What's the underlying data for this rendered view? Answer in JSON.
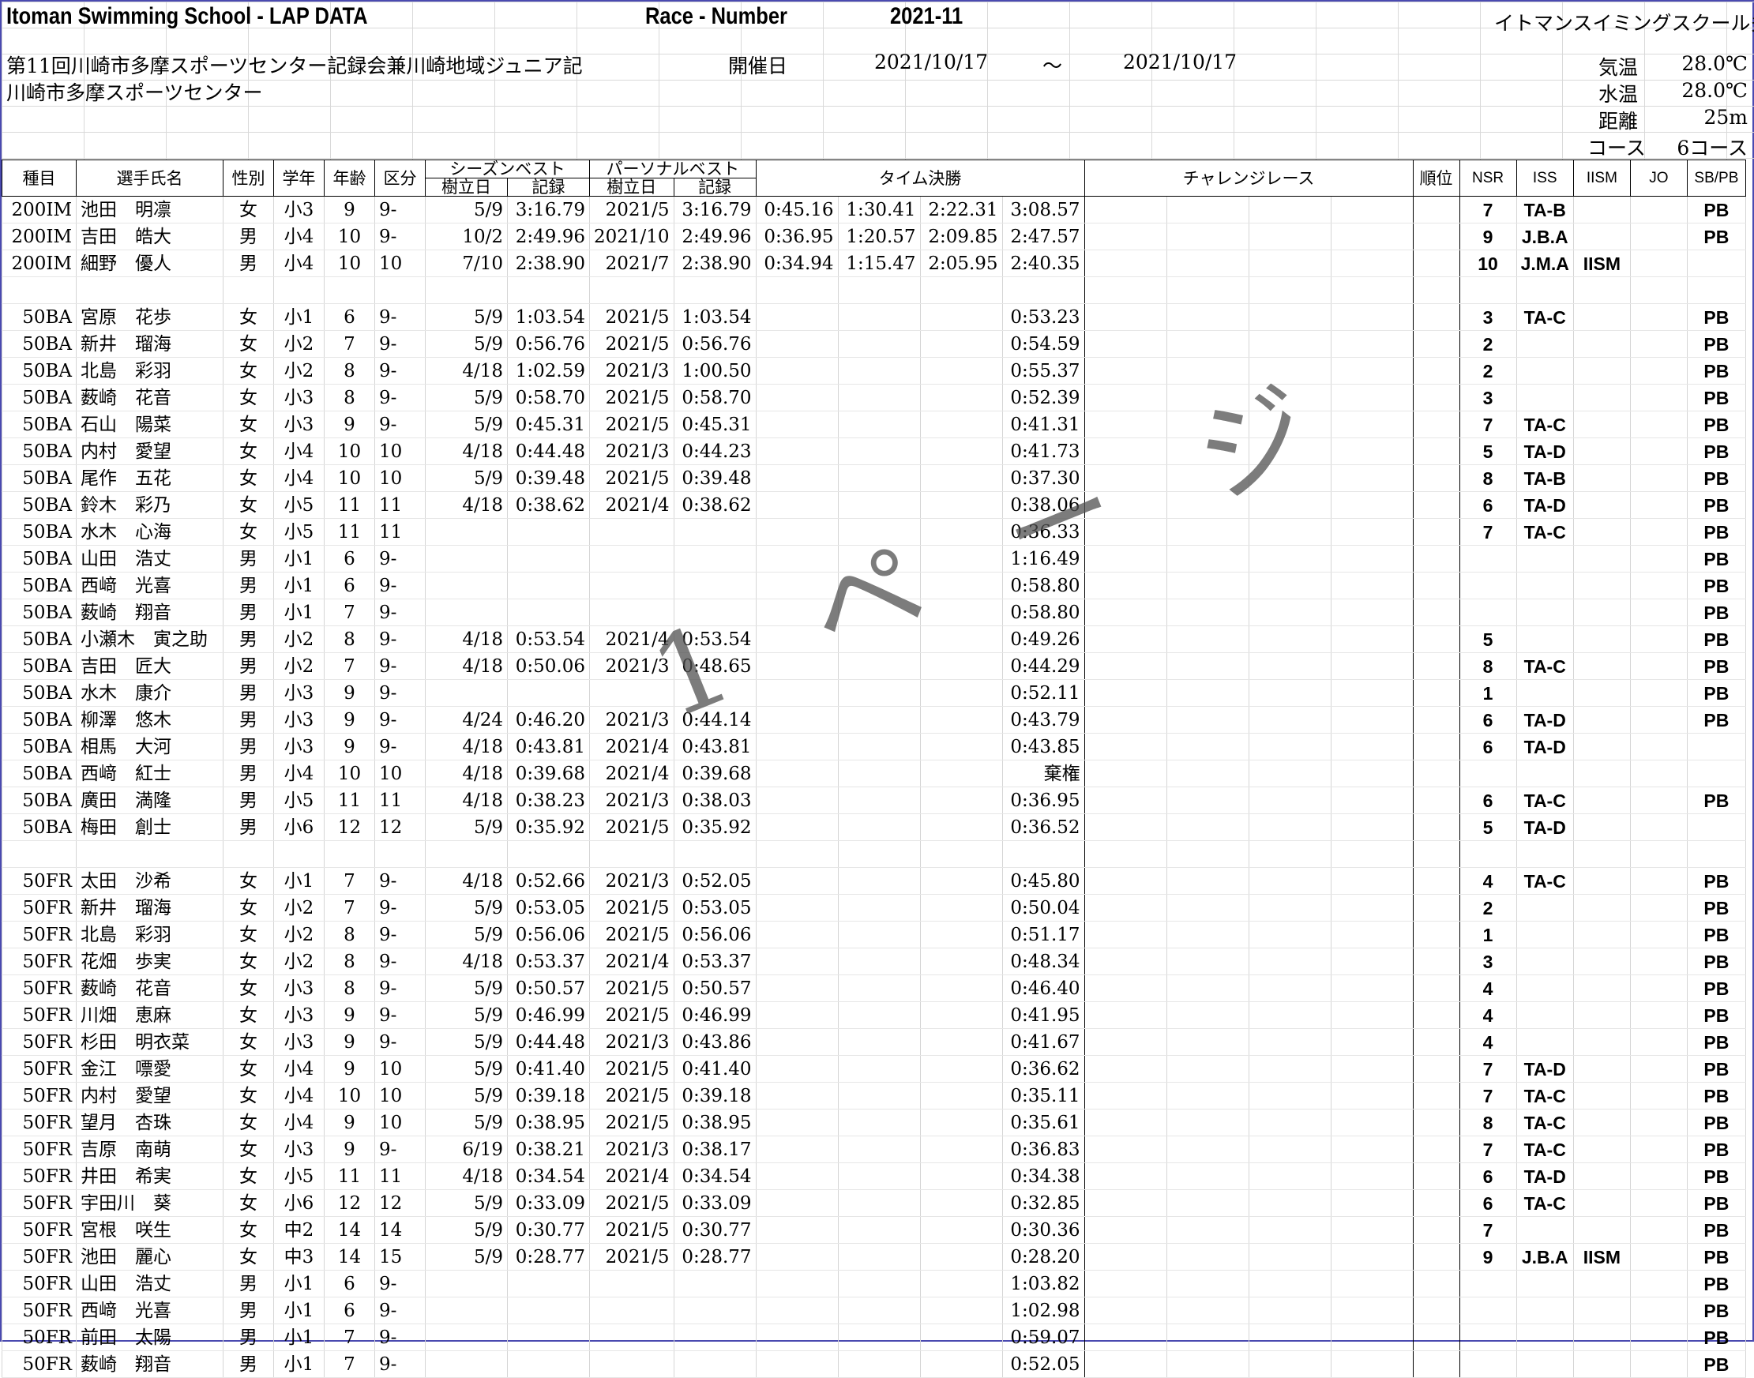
{
  "header": {
    "title": "Itoman Swimming School - LAP DATA",
    "race_number_label": "Race - Number",
    "period": "2021-11",
    "school": "イトマンスイミングスクール多摩校",
    "meet_name": "第11回川崎市多摩スポーツセンター記録会兼川崎地域ジュニア記",
    "venue": "川崎市多摩スポーツセンター",
    "date_label": "開催日",
    "date_from": "2021/10/17",
    "date_sep": "～",
    "date_to": "2021/10/17",
    "air_temp_label": "気温",
    "air_temp": "28.0℃",
    "water_temp_label": "水温",
    "water_temp": "28.0℃",
    "distance_label": "距離",
    "distance": "25m",
    "course_label": "コース",
    "course": "6コース"
  },
  "columns": {
    "event": "種目",
    "name": "選手氏名",
    "sex": "性別",
    "grade": "学年",
    "age": "年齢",
    "division": "区分",
    "season_best": "シーズンベスト",
    "personal_best": "パーソナルベスト",
    "set_date": "樹立日",
    "record": "記録",
    "time_final": "タイム決勝",
    "challenge": "チャレンジレース",
    "rank": "順位",
    "nsr": "NSR",
    "iss": "ISS",
    "iism": "IISM",
    "jo": "JO",
    "sbpb": "SB/PB"
  },
  "watermark": "1 ペ ー ジ",
  "rows": [
    [
      "200IM",
      "池田　明凛",
      "女",
      "小3",
      "9",
      "9-",
      "5/9",
      "3:16.79",
      "2021/5",
      "3:16.79",
      "0:45.16",
      "1:30.41",
      "2:22.31",
      "3:08.57",
      "7",
      "TA-B",
      "",
      "",
      "PB"
    ],
    [
      "200IM",
      "吉田　皓大",
      "男",
      "小4",
      "10",
      "9-",
      "10/2",
      "2:49.96",
      "2021/10",
      "2:49.96",
      "0:36.95",
      "1:20.57",
      "2:09.85",
      "2:47.57",
      "9",
      "J.B.A",
      "",
      "",
      "PB"
    ],
    [
      "200IM",
      "細野　優人",
      "男",
      "小4",
      "10",
      "10",
      "7/10",
      "2:38.90",
      "2021/7",
      "2:38.90",
      "0:34.94",
      "1:15.47",
      "2:05.95",
      "2:40.35",
      "10",
      "J.M.A",
      "IISM",
      "",
      ""
    ],
    [
      "",
      "",
      "",
      "",
      "",
      "",
      "",
      "",
      "",
      "",
      "",
      "",
      "",
      "",
      "",
      "",
      "",
      "",
      ""
    ],
    [
      "50BA",
      "宮原　花歩",
      "女",
      "小1",
      "6",
      "9-",
      "5/9",
      "1:03.54",
      "2021/5",
      "1:03.54",
      "",
      "",
      "",
      "0:53.23",
      "3",
      "TA-C",
      "",
      "",
      "PB"
    ],
    [
      "50BA",
      "新井　瑠海",
      "女",
      "小2",
      "7",
      "9-",
      "5/9",
      "0:56.76",
      "2021/5",
      "0:56.76",
      "",
      "",
      "",
      "0:54.59",
      "2",
      "",
      "",
      "",
      "PB"
    ],
    [
      "50BA",
      "北島　彩羽",
      "女",
      "小2",
      "8",
      "9-",
      "4/18",
      "1:02.59",
      "2021/3",
      "1:00.50",
      "",
      "",
      "",
      "0:55.37",
      "2",
      "",
      "",
      "",
      "PB"
    ],
    [
      "50BA",
      "薮崎　花音",
      "女",
      "小3",
      "8",
      "9-",
      "5/9",
      "0:58.70",
      "2021/5",
      "0:58.70",
      "",
      "",
      "",
      "0:52.39",
      "3",
      "",
      "",
      "",
      "PB"
    ],
    [
      "50BA",
      "石山　陽菜",
      "女",
      "小3",
      "9",
      "9-",
      "5/9",
      "0:45.31",
      "2021/5",
      "0:45.31",
      "",
      "",
      "",
      "0:41.31",
      "7",
      "TA-C",
      "",
      "",
      "PB"
    ],
    [
      "50BA",
      "内村　愛望",
      "女",
      "小4",
      "10",
      "10",
      "4/18",
      "0:44.48",
      "2021/3",
      "0:44.23",
      "",
      "",
      "",
      "0:41.73",
      "5",
      "TA-D",
      "",
      "",
      "PB"
    ],
    [
      "50BA",
      "尾作　五花",
      "女",
      "小4",
      "10",
      "10",
      "5/9",
      "0:39.48",
      "2021/5",
      "0:39.48",
      "",
      "",
      "",
      "0:37.30",
      "8",
      "TA-B",
      "",
      "",
      "PB"
    ],
    [
      "50BA",
      "鈴木　彩乃",
      "女",
      "小5",
      "11",
      "11",
      "4/18",
      "0:38.62",
      "2021/4",
      "0:38.62",
      "",
      "",
      "",
      "0:38.06",
      "6",
      "TA-D",
      "",
      "",
      "PB"
    ],
    [
      "50BA",
      "水木　心海",
      "女",
      "小5",
      "11",
      "11",
      "",
      "",
      "",
      "",
      "",
      "",
      "",
      "0:36.33",
      "7",
      "TA-C",
      "",
      "",
      "PB"
    ],
    [
      "50BA",
      "山田　浩丈",
      "男",
      "小1",
      "6",
      "9-",
      "",
      "",
      "",
      "",
      "",
      "",
      "",
      "1:16.49",
      "",
      "",
      "",
      "",
      "PB"
    ],
    [
      "50BA",
      "西﨑　光喜",
      "男",
      "小1",
      "6",
      "9-",
      "",
      "",
      "",
      "",
      "",
      "",
      "",
      "0:58.80",
      "",
      "",
      "",
      "",
      "PB"
    ],
    [
      "50BA",
      "薮崎　翔音",
      "男",
      "小1",
      "7",
      "9-",
      "",
      "",
      "",
      "",
      "",
      "",
      "",
      "0:58.80",
      "",
      "",
      "",
      "",
      "PB"
    ],
    [
      "50BA",
      "小瀬木　寅之助",
      "男",
      "小2",
      "8",
      "9-",
      "4/18",
      "0:53.54",
      "2021/4",
      "0:53.54",
      "",
      "",
      "",
      "0:49.26",
      "5",
      "",
      "",
      "",
      "PB"
    ],
    [
      "50BA",
      "吉田　匠大",
      "男",
      "小2",
      "7",
      "9-",
      "4/18",
      "0:50.06",
      "2021/3",
      "0:48.65",
      "",
      "",
      "",
      "0:44.29",
      "8",
      "TA-C",
      "",
      "",
      "PB"
    ],
    [
      "50BA",
      "水木　康介",
      "男",
      "小3",
      "9",
      "9-",
      "",
      "",
      "",
      "",
      "",
      "",
      "",
      "0:52.11",
      "1",
      "",
      "",
      "",
      "PB"
    ],
    [
      "50BA",
      "柳澤　悠木",
      "男",
      "小3",
      "9",
      "9-",
      "4/24",
      "0:46.20",
      "2021/3",
      "0:44.14",
      "",
      "",
      "",
      "0:43.79",
      "6",
      "TA-D",
      "",
      "",
      "PB"
    ],
    [
      "50BA",
      "相馬　大河",
      "男",
      "小3",
      "9",
      "9-",
      "4/18",
      "0:43.81",
      "2021/4",
      "0:43.81",
      "",
      "",
      "",
      "0:43.85",
      "6",
      "TA-D",
      "",
      "",
      ""
    ],
    [
      "50BA",
      "西﨑　紅士",
      "男",
      "小4",
      "10",
      "10",
      "4/18",
      "0:39.68",
      "2021/4",
      "0:39.68",
      "",
      "",
      "",
      "棄権",
      "",
      "",
      "",
      "",
      ""
    ],
    [
      "50BA",
      "廣田　満隆",
      "男",
      "小5",
      "11",
      "11",
      "4/18",
      "0:38.23",
      "2021/3",
      "0:38.03",
      "",
      "",
      "",
      "0:36.95",
      "6",
      "TA-C",
      "",
      "",
      "PB"
    ],
    [
      "50BA",
      "梅田　創士",
      "男",
      "小6",
      "12",
      "12",
      "5/9",
      "0:35.92",
      "2021/5",
      "0:35.92",
      "",
      "",
      "",
      "0:36.52",
      "5",
      "TA-D",
      "",
      "",
      ""
    ],
    [
      "",
      "",
      "",
      "",
      "",
      "",
      "",
      "",
      "",
      "",
      "",
      "",
      "",
      "",
      "",
      "",
      "",
      "",
      ""
    ],
    [
      "50FR",
      "太田　沙希",
      "女",
      "小1",
      "7",
      "9-",
      "4/18",
      "0:52.66",
      "2021/3",
      "0:52.05",
      "",
      "",
      "",
      "0:45.80",
      "4",
      "TA-C",
      "",
      "",
      "PB"
    ],
    [
      "50FR",
      "新井　瑠海",
      "女",
      "小2",
      "7",
      "9-",
      "5/9",
      "0:53.05",
      "2021/5",
      "0:53.05",
      "",
      "",
      "",
      "0:50.04",
      "2",
      "",
      "",
      "",
      "PB"
    ],
    [
      "50FR",
      "北島　彩羽",
      "女",
      "小2",
      "8",
      "9-",
      "5/9",
      "0:56.06",
      "2021/5",
      "0:56.06",
      "",
      "",
      "",
      "0:51.17",
      "1",
      "",
      "",
      "",
      "PB"
    ],
    [
      "50FR",
      "花畑　歩実",
      "女",
      "小2",
      "8",
      "9-",
      "4/18",
      "0:53.37",
      "2021/4",
      "0:53.37",
      "",
      "",
      "",
      "0:48.34",
      "3",
      "",
      "",
      "",
      "PB"
    ],
    [
      "50FR",
      "薮崎　花音",
      "女",
      "小3",
      "8",
      "9-",
      "5/9",
      "0:50.57",
      "2021/5",
      "0:50.57",
      "",
      "",
      "",
      "0:46.40",
      "4",
      "",
      "",
      "",
      "PB"
    ],
    [
      "50FR",
      "川畑　恵麻",
      "女",
      "小3",
      "9",
      "9-",
      "5/9",
      "0:46.99",
      "2021/5",
      "0:46.99",
      "",
      "",
      "",
      "0:41.95",
      "4",
      "",
      "",
      "",
      "PB"
    ],
    [
      "50FR",
      "杉田　明衣菜",
      "女",
      "小3",
      "9",
      "9-",
      "5/9",
      "0:44.48",
      "2021/3",
      "0:43.86",
      "",
      "",
      "",
      "0:41.67",
      "4",
      "",
      "",
      "",
      "PB"
    ],
    [
      "50FR",
      "金江　嘌愛",
      "女",
      "小4",
      "9",
      "10",
      "5/9",
      "0:41.40",
      "2021/5",
      "0:41.40",
      "",
      "",
      "",
      "0:36.62",
      "7",
      "TA-D",
      "",
      "",
      "PB"
    ],
    [
      "50FR",
      "内村　愛望",
      "女",
      "小4",
      "10",
      "10",
      "5/9",
      "0:39.18",
      "2021/5",
      "0:39.18",
      "",
      "",
      "",
      "0:35.11",
      "7",
      "TA-C",
      "",
      "",
      "PB"
    ],
    [
      "50FR",
      "望月　杏珠",
      "女",
      "小4",
      "9",
      "10",
      "5/9",
      "0:38.95",
      "2021/5",
      "0:38.95",
      "",
      "",
      "",
      "0:35.61",
      "8",
      "TA-C",
      "",
      "",
      "PB"
    ],
    [
      "50FR",
      "吉原　南萌",
      "女",
      "小3",
      "9",
      "9-",
      "6/19",
      "0:38.21",
      "2021/3",
      "0:38.17",
      "",
      "",
      "",
      "0:36.83",
      "7",
      "TA-C",
      "",
      "",
      "PB"
    ],
    [
      "50FR",
      "井田　希実",
      "女",
      "小5",
      "11",
      "11",
      "4/18",
      "0:34.54",
      "2021/4",
      "0:34.54",
      "",
      "",
      "",
      "0:34.38",
      "6",
      "TA-D",
      "",
      "",
      "PB"
    ],
    [
      "50FR",
      "宇田川　葵",
      "女",
      "小6",
      "12",
      "12",
      "5/9",
      "0:33.09",
      "2021/5",
      "0:33.09",
      "",
      "",
      "",
      "0:32.85",
      "6",
      "TA-C",
      "",
      "",
      "PB"
    ],
    [
      "50FR",
      "宮根　咲生",
      "女",
      "中2",
      "14",
      "14",
      "5/9",
      "0:30.77",
      "2021/5",
      "0:30.77",
      "",
      "",
      "",
      "0:30.36",
      "7",
      "",
      "",
      "",
      "PB"
    ],
    [
      "50FR",
      "池田　麗心",
      "女",
      "中3",
      "14",
      "15",
      "5/9",
      "0:28.77",
      "2021/5",
      "0:28.77",
      "",
      "",
      "",
      "0:28.20",
      "9",
      "J.B.A",
      "IISM",
      "",
      "PB"
    ],
    [
      "50FR",
      "山田　浩丈",
      "男",
      "小1",
      "6",
      "9-",
      "",
      "",
      "",
      "",
      "",
      "",
      "",
      "1:03.82",
      "",
      "",
      "",
      "",
      "PB"
    ],
    [
      "50FR",
      "西﨑　光喜",
      "男",
      "小1",
      "6",
      "9-",
      "",
      "",
      "",
      "",
      "",
      "",
      "",
      "1:02.98",
      "",
      "",
      "",
      "",
      "PB"
    ],
    [
      "50FR",
      "前田　太陽",
      "男",
      "小1",
      "7",
      "9-",
      "",
      "",
      "",
      "",
      "",
      "",
      "",
      "0:59.07",
      "",
      "",
      "",
      "",
      "PB"
    ],
    [
      "50FR",
      "薮崎　翔音",
      "男",
      "小1",
      "7",
      "9-",
      "",
      "",
      "",
      "",
      "",
      "",
      "",
      "0:52.05",
      "",
      "",
      "",
      "",
      "PB"
    ]
  ]
}
